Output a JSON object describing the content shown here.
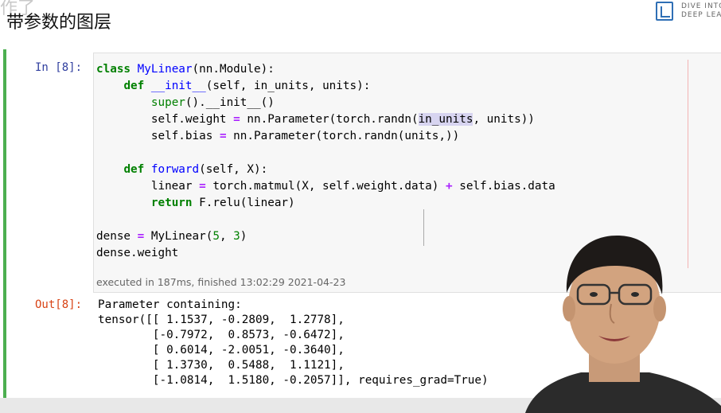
{
  "header": {
    "watermark": "作了",
    "title": "带参数的图层",
    "logo_text": "DIVE INTO\nDEEP LEA"
  },
  "cell_input": {
    "prompt": "In [8]:",
    "execution_info": "executed in 187ms, finished 13:02:29 2021-04-23",
    "code_lines": [
      "class MyLinear(nn.Module):",
      "    def __init__(self, in_units, units):",
      "        super().__init__()",
      "        self.weight = nn.Parameter(torch.randn(in_units, units))",
      "        self.bias = nn.Parameter(torch.randn(units,))",
      "",
      "    def forward(self, X):",
      "        linear = torch.matmul(X, self.weight.data) + self.bias.data",
      "        return F.relu(linear)",
      "",
      "dense = MyLinear(5, 3)",
      "dense.weight"
    ]
  },
  "cell_output": {
    "prompt": "Out[8]:",
    "lines": [
      "Parameter containing:",
      "tensor([[ 1.1537, -0.2809,  1.2778],",
      "        [-0.7972,  0.8573, -0.6472],",
      "        [ 0.6014, -2.0051, -0.3640],",
      "        [ 1.3730,  0.5488,  1.1121],",
      "        [-1.0814,  1.5180, -0.2057]], requires_grad=True)"
    ]
  },
  "colors": {
    "cell_border": "#4caf50",
    "in_prompt": "#303f9f",
    "out_prompt": "#d84315",
    "keyword": "#008000",
    "function_name": "#0000ff",
    "selection": "#d7d4f0"
  }
}
